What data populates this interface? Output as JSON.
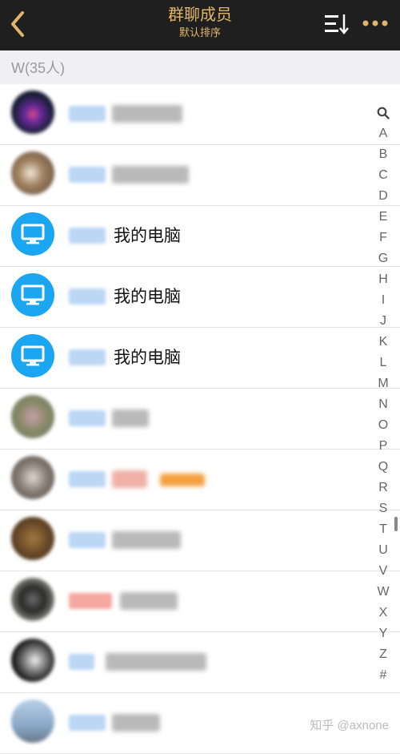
{
  "header": {
    "title": "群聊成员",
    "subtitle": "默认排序",
    "back_icon": "chevron-left-icon",
    "sort_icon": "sort-list-icon",
    "more_icon": "more-dots-icon",
    "accent": "#e2b66a",
    "background": "#1f1f1f"
  },
  "group": {
    "label": "W(35人)"
  },
  "members": [
    {
      "avatar": "blurred-photo",
      "name": ""
    },
    {
      "avatar": "blurred-photo",
      "name": ""
    },
    {
      "avatar": "monitor-icon",
      "name": "我的电脑"
    },
    {
      "avatar": "monitor-icon",
      "name": "我的电脑"
    },
    {
      "avatar": "monitor-icon",
      "name": "我的电脑"
    },
    {
      "avatar": "blurred-photo",
      "name": ""
    },
    {
      "avatar": "blurred-photo",
      "name": ""
    },
    {
      "avatar": "blurred-photo",
      "name": ""
    },
    {
      "avatar": "blurred-photo",
      "name": ""
    },
    {
      "avatar": "blurred-photo",
      "name": ""
    },
    {
      "avatar": "blurred-photo",
      "name": ""
    }
  ],
  "index": {
    "search_icon": "search-icon",
    "letters": [
      "A",
      "B",
      "C",
      "D",
      "E",
      "F",
      "G",
      "H",
      "I",
      "J",
      "K",
      "L",
      "M",
      "N",
      "O",
      "P",
      "Q",
      "R",
      "S",
      "T",
      "U",
      "V",
      "W",
      "X",
      "Y",
      "Z",
      "#"
    ]
  },
  "watermark": "知乎 @axnone"
}
